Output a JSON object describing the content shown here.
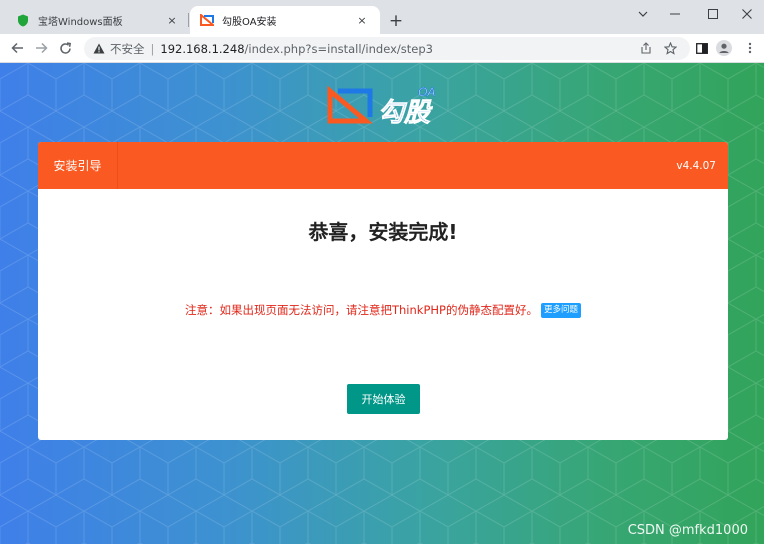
{
  "browser": {
    "tabs": [
      {
        "title": "宝塔Windows面板",
        "icon": "shield-icon",
        "active": false
      },
      {
        "title": "勾股OA安装",
        "icon": "gougu-logo-icon",
        "active": true
      }
    ],
    "new_tab_symbol": "+",
    "close_symbol": "×",
    "security_label": "不安全",
    "url_host": "192.168.1.248",
    "url_path": "/index.php?s=install/index/step3"
  },
  "page": {
    "logo": {
      "badge": "OA",
      "name": "勾股"
    },
    "header": {
      "guide_label": "安装引导",
      "version": "v4.4.07"
    },
    "title": "恭喜，安装完成!",
    "notice": "注意：如果出现页面无法访问，请注意把ThinkPHP的伪静态配置好。",
    "more_label": "更多问题",
    "start_button": "开始体验",
    "watermark": "CSDN @mfkd1000"
  },
  "colors": {
    "header_orange": "#fa5a21",
    "notice_red": "#e0271a",
    "more_blue": "#1e9fff",
    "button_teal": "#009688",
    "gradient_start": "#3f7fe9",
    "gradient_end": "#32a45a"
  }
}
